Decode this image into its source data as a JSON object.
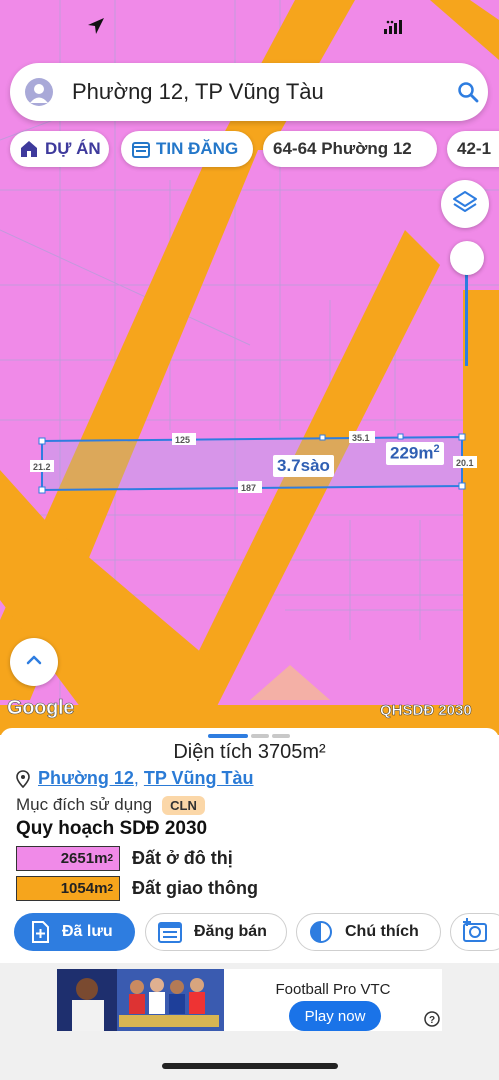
{
  "colors": {
    "map_residential": "#f08ae8",
    "map_traffic": "#f6a51c",
    "accent": "#2e7de0",
    "parcel_outline": "#2e7de0"
  },
  "map": {
    "parcel_edges": {
      "top_left": "125",
      "top_right": "35.1",
      "left": "21.2",
      "right": "20.1",
      "bottom": "187"
    },
    "area_sao": "3.7sào",
    "area_m2_value": "229m",
    "area_m2_unit": "2",
    "google_logo": "Google",
    "layer_name": "QHSDĐ 2030",
    "icons": {
      "nav": "navigation-arrow-icon",
      "layers": "layers-icon",
      "up": "chevron-up-icon",
      "signal": "signal-icon"
    }
  },
  "search": {
    "query": "Phường 12, TP Vũng Tàu"
  },
  "chips": [
    {
      "label": "DỰ ÁN",
      "icon": "house-icon"
    },
    {
      "label": "TIN ĐĂNG",
      "icon": "calendar-icon"
    },
    {
      "label": "64-64 Phường 12"
    },
    {
      "label": "42-1"
    }
  ],
  "sheet": {
    "title": "Diện tích 3705m²",
    "location": {
      "ward": "Phường 12",
      "separator": ",",
      "city": "TP Vũng Tàu"
    },
    "purpose_label": "Mục đích sử dụng",
    "purpose_badge": "CLN",
    "plan_title": "Quy hoạch SDĐ 2030",
    "legend": [
      {
        "value": "2651m",
        "unit": "2",
        "desc": "Đất ở đô thị",
        "color": "#f08ae8"
      },
      {
        "value": "1054m",
        "unit": "2",
        "desc": "Đất giao thông",
        "color": "#f6a51c"
      }
    ],
    "actions": {
      "saved": "Đã lưu",
      "post": "Đăng bán",
      "note": "Chú thích"
    }
  },
  "ad": {
    "title": "Football Pro VTC",
    "button": "Play now"
  }
}
